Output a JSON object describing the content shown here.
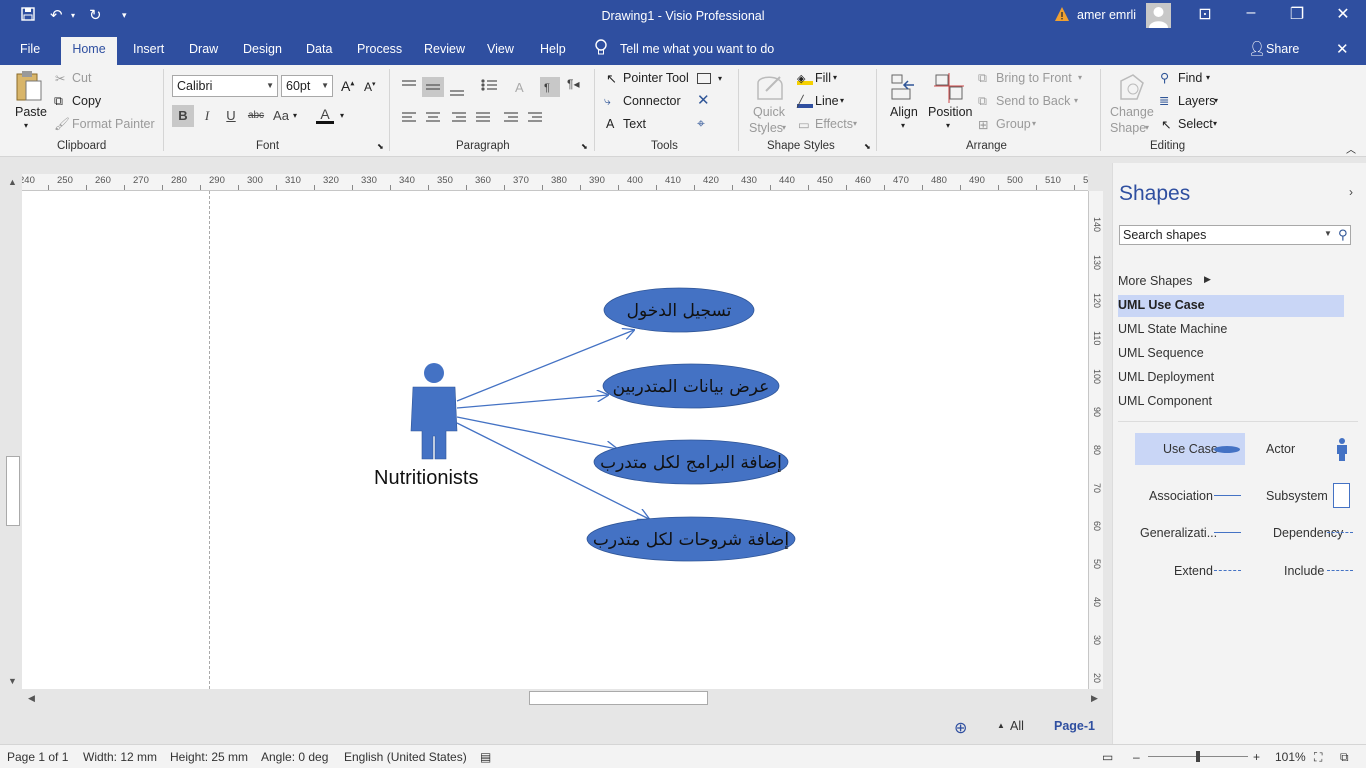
{
  "app": {
    "title": "Drawing1  -  Visio Professional",
    "user": "amer emrli",
    "share": "Share",
    "tell_me": "Tell me what you want to do"
  },
  "tabs": [
    "File",
    "Home",
    "Insert",
    "Draw",
    "Design",
    "Data",
    "Process",
    "Review",
    "View",
    "Help"
  ],
  "ribbon": {
    "clipboard": {
      "paste": "Paste",
      "cut": "Cut",
      "copy": "Copy",
      "format_painter": "Format Painter",
      "label": "Clipboard"
    },
    "font": {
      "family": "Calibri",
      "size": "60pt",
      "bold": "B",
      "italic": "I",
      "underline": "U",
      "strike": "abc",
      "case": "Aa",
      "label": "Font"
    },
    "paragraph": {
      "label": "Paragraph"
    },
    "tools": {
      "pointer": "Pointer Tool",
      "connector": "Connector",
      "text": "Text",
      "label": "Tools"
    },
    "shape_styles": {
      "quick": "Quick",
      "styles": "Styles",
      "fill": "Fill",
      "line": "Line",
      "effects": "Effects",
      "label": "Shape Styles"
    },
    "arrange": {
      "align": "Align",
      "position": "Position",
      "bring_front": "Bring to Front",
      "send_back": "Send to Back",
      "group": "Group",
      "label": "Arrange"
    },
    "editing": {
      "change": "Change",
      "shape": "Shape",
      "find": "Find",
      "layers": "Layers",
      "select": "Select",
      "label": "Editing"
    }
  },
  "ruler": {
    "h_ticks": [
      "240",
      "250",
      "260",
      "270",
      "280",
      "290",
      "300",
      "310",
      "320",
      "330",
      "340",
      "350",
      "360",
      "370",
      "380",
      "390",
      "400",
      "410",
      "420",
      "430",
      "440",
      "450",
      "460",
      "470",
      "480",
      "490",
      "500",
      "510",
      "5"
    ],
    "v_ticks": [
      "140",
      "130",
      "120",
      "110",
      "100",
      "90",
      "80",
      "70",
      "60",
      "50",
      "40",
      "30",
      "20"
    ]
  },
  "diagram": {
    "actor": "Nutritionists",
    "use_cases": [
      "تسجيل الدخول",
      "عرض بيانات المتدربين",
      "إضافة البرامج لكل متدرب",
      "إضافة شروحات لكل متدرب"
    ],
    "fill_color": "#4472c4",
    "stroke_color": "#2f5597"
  },
  "shapes_pane": {
    "title": "Shapes",
    "search_placeholder": "Search shapes",
    "more_shapes": "More Shapes",
    "stencils": [
      "UML Use Case",
      "UML State Machine",
      "UML Sequence",
      "UML Deployment",
      "UML Component"
    ],
    "active_stencil": "UML Use Case",
    "masters": [
      "Use Case",
      "Actor",
      "Association",
      "Subsystem",
      "Generalizati...",
      "Dependency",
      "Extend",
      "Include"
    ]
  },
  "page_tabs": {
    "all": "All",
    "page": "Page-1"
  },
  "status": {
    "page": "Page 1 of 1",
    "width": "Width: 12 mm",
    "height": "Height: 25 mm",
    "angle": "Angle: 0 deg",
    "language": "English (United States)",
    "zoom": "101%"
  }
}
